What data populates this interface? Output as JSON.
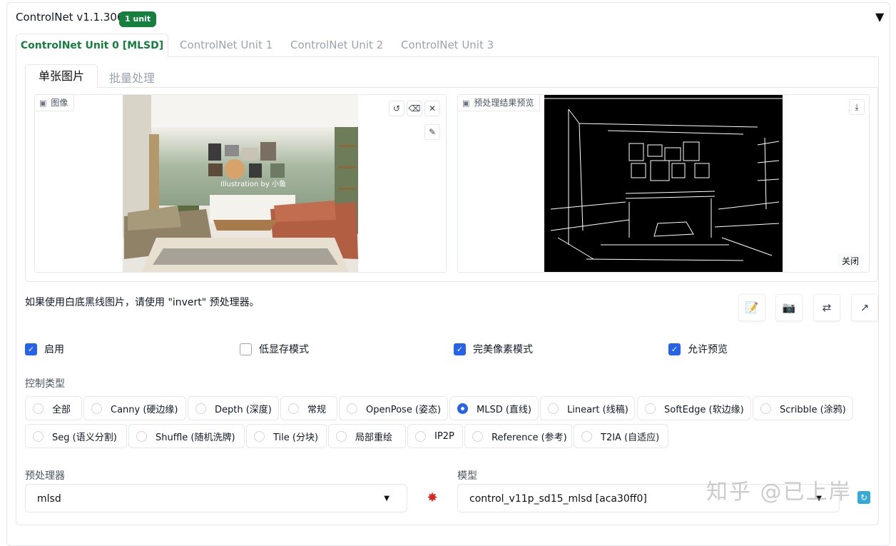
{
  "header": {
    "title": "ControlNet v1.1.306",
    "badge": "1 unit",
    "collapse_icon": "triangle-down-icon"
  },
  "unit_tabs": [
    {
      "label": "ControlNet Unit 0 [MLSD]",
      "active": true
    },
    {
      "label": "ControlNet Unit 1",
      "active": false
    },
    {
      "label": "ControlNet Unit 2",
      "active": false
    },
    {
      "label": "ControlNet Unit 3",
      "active": false
    }
  ],
  "image_tabs": [
    {
      "label": "单张图片",
      "active": true
    },
    {
      "label": "批量处理",
      "active": false
    }
  ],
  "input_image": {
    "label": "图像",
    "watermark_text": "Illustration by 小鱼",
    "tools": [
      "undo-icon",
      "eraser-icon",
      "close-icon",
      "brush-icon"
    ]
  },
  "preview_image": {
    "label": "预处理结果预览",
    "close_label": "关闭",
    "tools": [
      "download-icon"
    ]
  },
  "hint": "如果使用白底黑线图片，请使用 \"invert\" 预处理器。",
  "action_buttons": [
    "edit-icon",
    "camera-icon",
    "swap-icon",
    "send-icon"
  ],
  "options": [
    {
      "label": "启用",
      "checked": true
    },
    {
      "label": "低显存模式",
      "checked": false
    },
    {
      "label": "完美像素模式",
      "checked": true
    },
    {
      "label": "允许预览",
      "checked": true
    }
  ],
  "control_type": {
    "label": "控制类型",
    "items": [
      {
        "label": "全部",
        "selected": false
      },
      {
        "label": "Canny (硬边缘)",
        "selected": false
      },
      {
        "label": "Depth (深度)",
        "selected": false
      },
      {
        "label": "常规",
        "selected": false
      },
      {
        "label": "OpenPose (姿态)",
        "selected": false
      },
      {
        "label": "MLSD (直线)",
        "selected": true
      },
      {
        "label": "Lineart (线稿)",
        "selected": false
      },
      {
        "label": "SoftEdge (软边缘)",
        "selected": false
      },
      {
        "label": "Scribble (涂鸦)",
        "selected": false
      },
      {
        "label": "Seg (语义分割)",
        "selected": false
      },
      {
        "label": "Shuffle (随机洗牌)",
        "selected": false
      },
      {
        "label": "Tile (分块)",
        "selected": false
      },
      {
        "label": "局部重绘",
        "selected": false
      },
      {
        "label": "IP2P",
        "selected": false
      },
      {
        "label": "Reference (参考)",
        "selected": false
      },
      {
        "label": "T2IA (自适应)",
        "selected": false
      }
    ]
  },
  "preprocessor": {
    "label": "预处理器",
    "value": "mlsd"
  },
  "model": {
    "label": "模型",
    "value": "control_v11p_sd15_mlsd [aca30ff0]"
  },
  "watermark": "知乎 @已上岸",
  "colors": {
    "accent": "#2563eb",
    "green": "#15803d"
  }
}
